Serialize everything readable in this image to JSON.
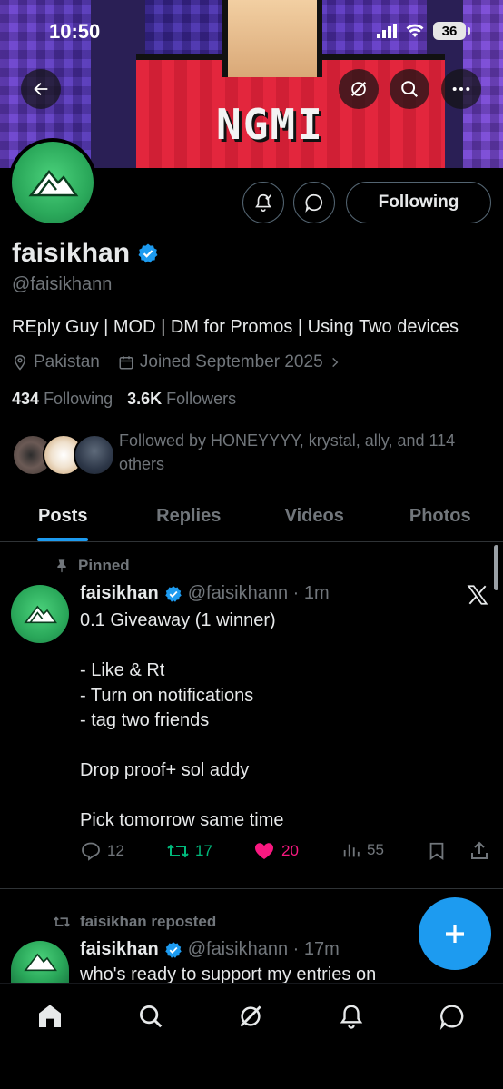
{
  "status_bar": {
    "time": "10:50",
    "battery": "36"
  },
  "banner": {
    "text": "NGMI"
  },
  "profile": {
    "display_name": "faisikhan",
    "handle": "@faisikhann",
    "bio": "REply Guy | MOD | DM for Promos | Using Two devices",
    "location": "Pakistan",
    "joined": "Joined September 2025",
    "following_count": "434",
    "following_label": "Following",
    "followers_count": "3.6K",
    "followers_label": "Followers",
    "followed_by": "Followed by HONEYYYY, krystal, ally, and 114 others",
    "follow_button_label": "Following"
  },
  "tabs": [
    {
      "label": "Posts",
      "active": true
    },
    {
      "label": "Replies",
      "active": false
    },
    {
      "label": "Videos",
      "active": false
    },
    {
      "label": "Photos",
      "active": false
    }
  ],
  "posts": [
    {
      "pinned_label": "Pinned",
      "name": "faisikhan",
      "handle_time": "@faisikhann · 1m",
      "text": "0.1 Giveaway (1 winner)\n\n- Like & Rt\n- Turn on notifications\n- tag two friends\n\nDrop proof+ sol addy\n\nPick tomorrow same time",
      "replies": "12",
      "reposts": "17",
      "likes": "20",
      "views": "55"
    },
    {
      "reposted_label": "faisikhan reposted",
      "name": "faisikhan",
      "handle_time": "@faisikhann · 17m",
      "text": "who's ready to support my entries on"
    }
  ],
  "colors": {
    "accent": "#1d9bf0",
    "like": "#f91880",
    "repost": "#00ba7c",
    "muted": "#71767b"
  }
}
